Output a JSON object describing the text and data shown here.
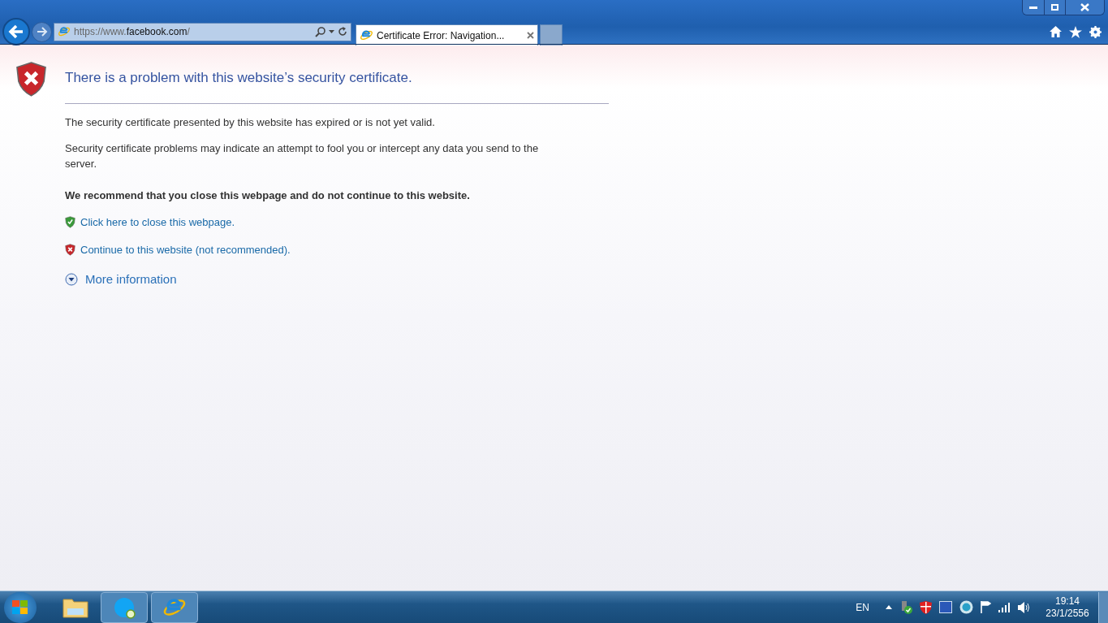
{
  "browser": {
    "address": {
      "prefix": "https://www.",
      "domain": "facebook.com",
      "suffix": "/"
    },
    "tabs": [
      {
        "title": "Certificate Error: Navigation...",
        "selected": true
      }
    ]
  },
  "page": {
    "heading": "There is a problem with this website’s security certificate.",
    "paragraphs": [
      "The security certificate presented by this website has expired or is not yet valid.",
      "Security certificate problems may indicate an attempt to fool you or intercept any data you send to the server."
    ],
    "recommendation": "We recommend that you close this webpage and do not continue to this website.",
    "links": [
      {
        "kind": "safe",
        "label": "Click here to close this webpage."
      },
      {
        "kind": "unsafe",
        "label": "Continue to this website (not recommended)."
      }
    ],
    "more_info": {
      "label": "More information",
      "expanded": false
    }
  },
  "taskbar": {
    "language": "EN",
    "time": "19:14",
    "date": "23/1/2556"
  }
}
